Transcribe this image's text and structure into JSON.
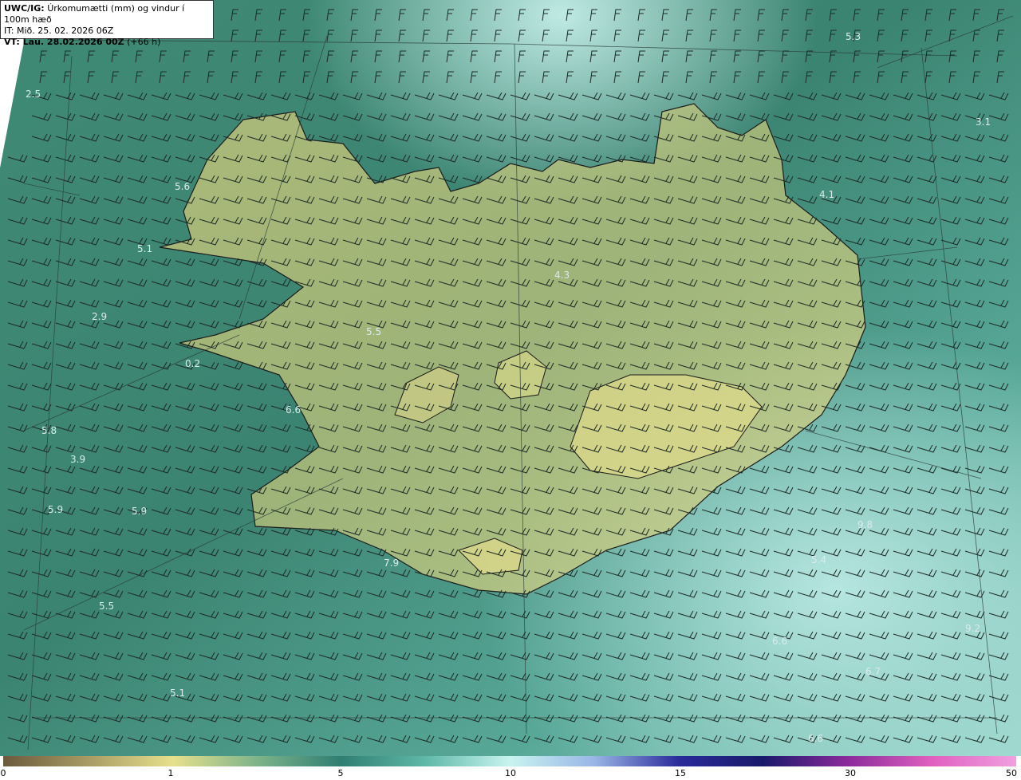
{
  "header": {
    "model": "UWC/IG:",
    "title": "Úrkomumætti (mm) og vindur í 100m hæð",
    "init_time": "IT: Mið. 25. 02. 2026 06Z",
    "valid_prefix": "VT: Lau. 28.02.2026 00Z",
    "valid_suffix": "(+66 h)"
  },
  "colorbar": {
    "ticks": [
      "0",
      "1",
      "5",
      "10",
      "15",
      "30",
      "50"
    ],
    "colors": [
      "#6b5a3c",
      "#a89a64",
      "#e6e08c",
      "#7fb48a",
      "#2f7f72",
      "#5fb8a8",
      "#c8f4f0",
      "#9ab6e6",
      "#2a2a9a",
      "#1a1a6a",
      "#8a2a9a",
      "#e060c0",
      "#f0a0e0"
    ]
  },
  "map_labels": [
    {
      "text": "5.3"
    },
    {
      "text": "2.5"
    },
    {
      "text": "3.1"
    },
    {
      "text": "5.6"
    },
    {
      "text": "4.1"
    },
    {
      "text": "5.1"
    },
    {
      "text": "4.3"
    },
    {
      "text": "2.9"
    },
    {
      "text": "5.5"
    },
    {
      "text": "0.2"
    },
    {
      "text": "6.6"
    },
    {
      "text": "5.8"
    },
    {
      "text": "3.9"
    },
    {
      "text": "5.9"
    },
    {
      "text": "5.9"
    },
    {
      "text": "9.8"
    },
    {
      "text": "7.9"
    },
    {
      "text": "5.4"
    },
    {
      "text": "5.5"
    },
    {
      "text": "9.2"
    },
    {
      "text": "6.6"
    },
    {
      "text": "6.7"
    },
    {
      "text": "5.1"
    },
    {
      "text": "6.6"
    }
  ]
}
